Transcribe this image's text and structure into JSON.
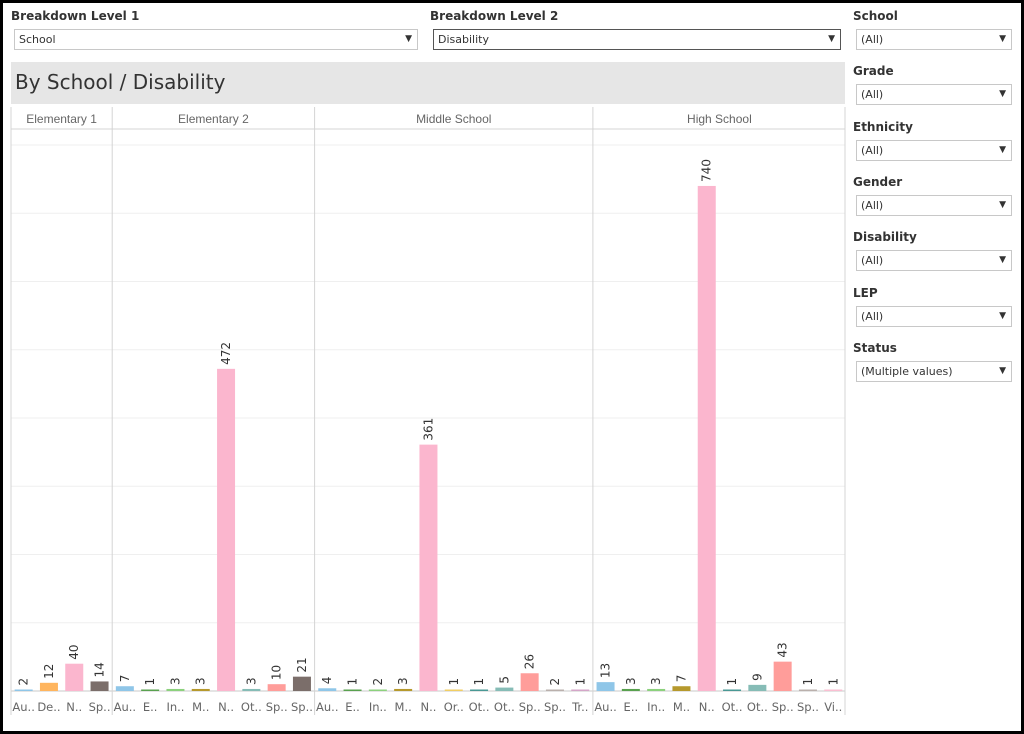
{
  "controls": {
    "level1": {
      "label": "Breakdown Level 1",
      "value": "School"
    },
    "level2": {
      "label": "Breakdown Level 2",
      "value": "Disability"
    }
  },
  "filters": [
    {
      "label": "School",
      "value": "(All)"
    },
    {
      "label": "Grade",
      "value": "(All)"
    },
    {
      "label": "Ethnicity",
      "value": "(All)"
    },
    {
      "label": "Gender",
      "value": "(All)"
    },
    {
      "label": "Disability",
      "value": "(All)"
    },
    {
      "label": "LEP",
      "value": "(All)"
    },
    {
      "label": "Status",
      "value": "(Multiple values)"
    }
  ],
  "title": "By School / Disability",
  "icons": {
    "dropdown": "triangle-down-icon"
  },
  "chart_data": {
    "type": "bar",
    "ylim": [
      0,
      800
    ],
    "grid": true,
    "y_axis_visible": false,
    "panes": [
      {
        "name": "Elementary 1",
        "bars": [
          {
            "label": "Au..",
            "value": 2,
            "color": "#8fc6e8"
          },
          {
            "label": "De..",
            "value": 12,
            "color": "#ffb55e"
          },
          {
            "label": "N..",
            "value": 40,
            "color": "#fbb6ce"
          },
          {
            "label": "Sp..",
            "value": 14,
            "color": "#7b6e6a"
          }
        ]
      },
      {
        "name": "Elementary 2",
        "bars": [
          {
            "label": "Au..",
            "value": 7,
            "color": "#8fc6e8"
          },
          {
            "label": "E..",
            "value": 1,
            "color": "#59a14f"
          },
          {
            "label": "In..",
            "value": 3,
            "color": "#8cd17d"
          },
          {
            "label": "M..",
            "value": 3,
            "color": "#b6992d"
          },
          {
            "label": "N..",
            "value": 472,
            "color": "#fbb6ce"
          },
          {
            "label": "Ot..",
            "value": 3,
            "color": "#86bcb6"
          },
          {
            "label": "Sp..",
            "value": 10,
            "color": "#ff9d9a"
          },
          {
            "label": "Sp..",
            "value": 21,
            "color": "#7b6e6a"
          }
        ]
      },
      {
        "name": "Middle School",
        "bars": [
          {
            "label": "Au..",
            "value": 4,
            "color": "#8fc6e8"
          },
          {
            "label": "E..",
            "value": 1,
            "color": "#59a14f"
          },
          {
            "label": "In..",
            "value": 2,
            "color": "#8cd17d"
          },
          {
            "label": "M..",
            "value": 3,
            "color": "#b6992d"
          },
          {
            "label": "N..",
            "value": 361,
            "color": "#fbb6ce"
          },
          {
            "label": "Or..",
            "value": 1,
            "color": "#f1ce63"
          },
          {
            "label": "Ot..",
            "value": 1,
            "color": "#499894"
          },
          {
            "label": "Ot..",
            "value": 5,
            "color": "#86bcb6"
          },
          {
            "label": "Sp..",
            "value": 26,
            "color": "#ff9d9a"
          },
          {
            "label": "Sp..",
            "value": 2,
            "color": "#bab0ac"
          },
          {
            "label": "Tr..",
            "value": 1,
            "color": "#d4a6c8"
          }
        ]
      },
      {
        "name": "High School",
        "bars": [
          {
            "label": "Au..",
            "value": 13,
            "color": "#8fc6e8"
          },
          {
            "label": "E..",
            "value": 3,
            "color": "#59a14f"
          },
          {
            "label": "In..",
            "value": 3,
            "color": "#8cd17d"
          },
          {
            "label": "M..",
            "value": 7,
            "color": "#b6992d"
          },
          {
            "label": "N..",
            "value": 740,
            "color": "#fbb6ce"
          },
          {
            "label": "Ot..",
            "value": 1,
            "color": "#499894"
          },
          {
            "label": "Ot..",
            "value": 9,
            "color": "#86bcb6"
          },
          {
            "label": "Sp..",
            "value": 43,
            "color": "#ff9d9a"
          },
          {
            "label": "Sp..",
            "value": 1,
            "color": "#bab0ac"
          },
          {
            "label": "Vi..",
            "value": 1,
            "color": "#fabfd2"
          }
        ]
      }
    ]
  }
}
